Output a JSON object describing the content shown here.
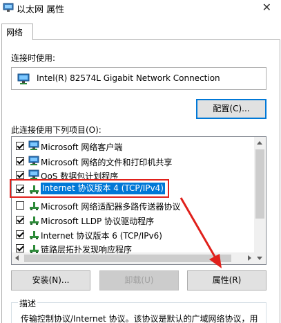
{
  "window": {
    "title": "以太网 属性",
    "close_glyph": "✕"
  },
  "tabs": [
    {
      "label": "网络"
    }
  ],
  "connect_using": {
    "label": "连接时使用:",
    "adapter_name": "Intel(R) 82574L Gigabit Network Connection",
    "configure_label": "配置(C)..."
  },
  "items_section": {
    "label": "此连接使用下列项目(O):",
    "items": [
      {
        "label": "Microsoft 网络客户端",
        "checked": true,
        "icon": "network-client-icon"
      },
      {
        "label": "Microsoft 网络的文件和打印机共享",
        "checked": true,
        "icon": "network-client-icon"
      },
      {
        "label": "QoS 数据包计划程序",
        "checked": true,
        "icon": "network-client-icon"
      },
      {
        "label": "Internet 协议版本 4 (TCP/IPv4)",
        "checked": true,
        "icon": "protocol-icon",
        "selected": true
      },
      {
        "label": "Microsoft 网络适配器多路传送器协议",
        "checked": false,
        "icon": "protocol-icon"
      },
      {
        "label": "Microsoft LLDP 协议驱动程序",
        "checked": true,
        "icon": "protocol-icon"
      },
      {
        "label": "Internet 协议版本 6 (TCP/IPv6)",
        "checked": true,
        "icon": "protocol-icon"
      },
      {
        "label": "链路层拓扑发现响应程序",
        "checked": true,
        "icon": "protocol-icon"
      }
    ]
  },
  "buttons": {
    "install": "安装(N)...",
    "uninstall": "卸载(U)",
    "properties": "属性(R)"
  },
  "description": {
    "title": "描述",
    "text": "传输控制协议/Internet 协议。该协议是默认的广域网络协议，用"
  },
  "colors": {
    "selection": "#0078d7",
    "annotation_red": "#e0201b",
    "focus_border": "#0078d7"
  }
}
